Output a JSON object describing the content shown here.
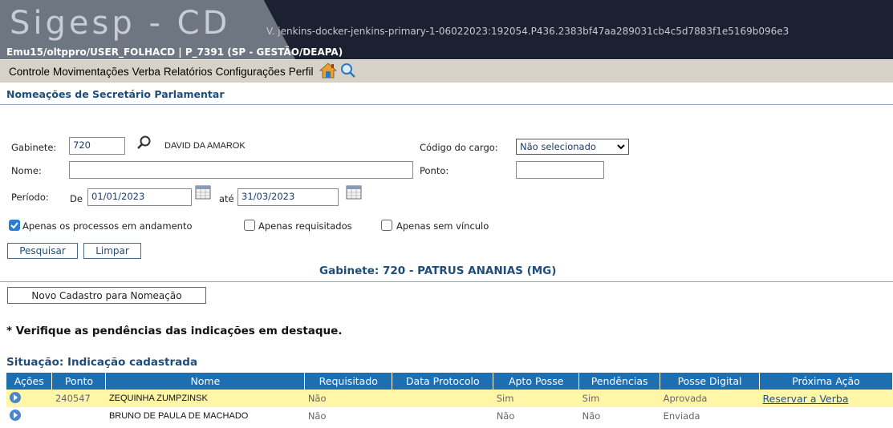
{
  "header": {
    "logo": "Sigesp - CD",
    "version": "V. jenkins-docker-jenkins-primary-1-06022023:192054.P436.2383bf47aa289031cb4c5d7883f1e5169b096e3",
    "userline": "Emu15/oltppro/USER_FOLHACD | P_7391 (SP - GESTÃO/DEAPA)"
  },
  "menu": {
    "items": [
      "Controle",
      "Movimentações",
      "Verba",
      "Relatórios",
      "Configurações",
      "Perfil"
    ],
    "icons": [
      "home-icon",
      "search-icon"
    ]
  },
  "page_title": "Nomeações de Secretário Parlamentar",
  "form": {
    "gabinete_label": "Gabinete:",
    "gabinete_value": "720",
    "gabinete_name": "DAVID DA AMAROK",
    "codigo_label": "Código do cargo:",
    "codigo_value": "Não selecionado",
    "nome_label": "Nome:",
    "nome_value": "",
    "ponto_label": "Ponto:",
    "ponto_value": "",
    "periodo_label": "Período:",
    "de_label": "De",
    "de_value": "01/01/2023",
    "ate_label": "até",
    "ate_value": "31/03/2023",
    "chk_andamento": "Apenas os processos em andamento",
    "chk_requisitados": "Apenas requisitados",
    "chk_sem_vinculo": "Apenas sem vínculo",
    "btn_pesquisar": "Pesquisar",
    "btn_limpar": "Limpar"
  },
  "gabinete_title": "Gabinete: 720 - PATRUS ANANIAS (MG)",
  "btn_novo": "Novo Cadastro para Nomeação",
  "note": "* Verifique as pendências das indicações em destaque.",
  "situacao": "Situação: Indicação cadastrada",
  "table": {
    "headers": [
      "Ações",
      "Ponto",
      "Nome",
      "Requisitado",
      "Data Protocolo",
      "Apto Posse",
      "Pendências",
      "Posse Digital",
      "Próxima Ação"
    ],
    "rows": [
      {
        "ponto": "240547",
        "nome": "ZEQUINHA ZUMPZINSK",
        "requisitado": "Não",
        "data_protocolo": "",
        "apto_posse": "Sim",
        "pendencias": "Sim",
        "posse_digital": "Aprovada",
        "proxima_acao": "Reservar a Verba",
        "highlight": true
      },
      {
        "ponto": "",
        "nome": "BRUNO DE PAULA DE MACHADO",
        "requisitado": "Não",
        "data_protocolo": "",
        "apto_posse": "Não",
        "pendencias": "Não",
        "posse_digital": "Enviada",
        "proxima_acao": "",
        "highlight": false
      }
    ]
  },
  "colors": {
    "table_header": "#1e6fb0",
    "highlight_row": "#fff6a8",
    "title": "#1e4d7a"
  }
}
